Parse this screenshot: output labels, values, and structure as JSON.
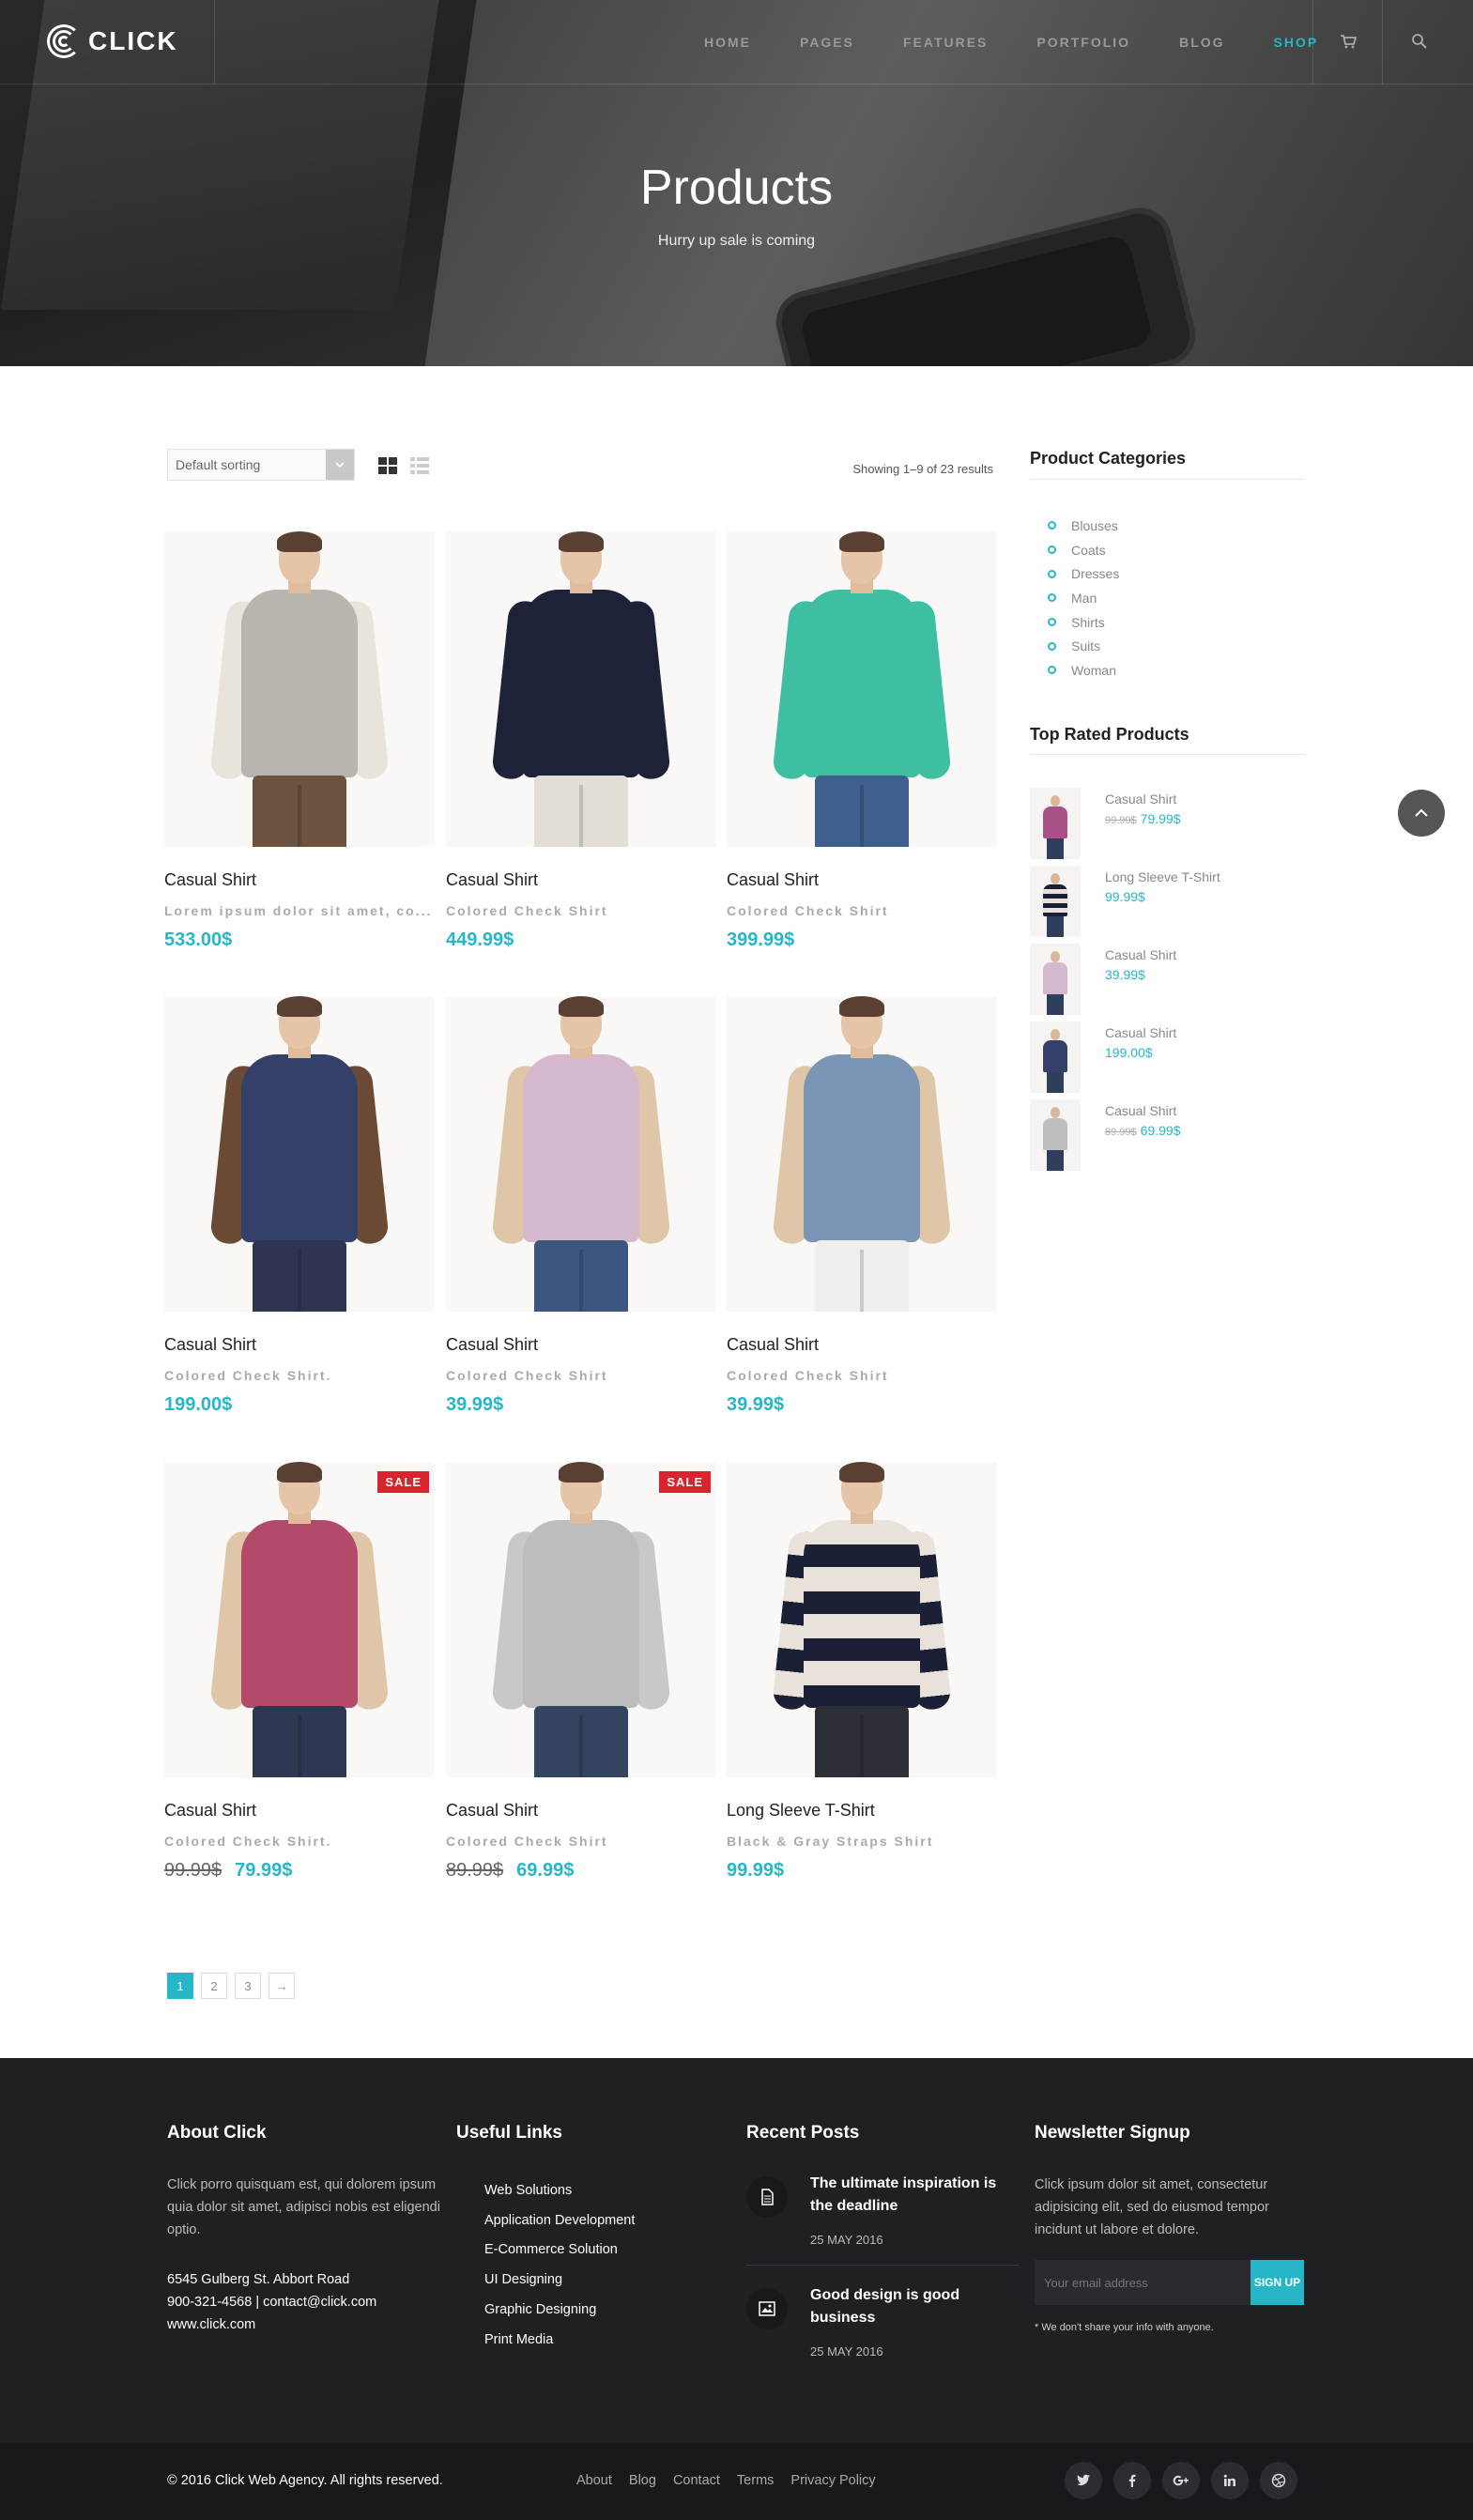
{
  "brand": {
    "logo_text": "CLICK"
  },
  "nav": {
    "items": [
      "HOME",
      "PAGES",
      "FEATURES",
      "PORTFOLIO",
      "BLOG",
      "SHOP"
    ],
    "active": "SHOP"
  },
  "hero": {
    "title": "Products",
    "subtitle": "Hurry up sale is coming"
  },
  "toolbar": {
    "sort_value": "Default sorting",
    "results": "Showing 1–9 of 23 results"
  },
  "products": [
    {
      "name": "Casual Shirt",
      "desc": "Lorem ipsum dolor sit amet, co...",
      "price": "533.00$",
      "old_price": "",
      "sale": false,
      "shirt": "#b9b5ae",
      "sleeve": "#e8e4dc",
      "pants": "#6b5340"
    },
    {
      "name": "Casual Shirt",
      "desc": "Colored Check Shirt",
      "price": "449.99$",
      "old_price": "",
      "sale": false,
      "shirt": "#1e2238",
      "sleeve": "#1e2238",
      "pants": "#e2ded5"
    },
    {
      "name": "Casual Shirt",
      "desc": "Colored Check Shirt",
      "price": "399.99$",
      "old_price": "",
      "sale": false,
      "shirt": "#3fbfa2",
      "sleeve": "#3fbfa2",
      "pants": "#3f5f8e"
    },
    {
      "name": "Casual Shirt",
      "desc": "Colored Check Shirt.",
      "price": "199.00$",
      "old_price": "",
      "sale": false,
      "shirt": "#34406a",
      "sleeve": "#6b4a35",
      "pants": "#2d3550"
    },
    {
      "name": "Casual Shirt",
      "desc": "Colored Check Shirt",
      "price": "39.99$",
      "old_price": "",
      "sale": false,
      "shirt": "#d5b8cc",
      "sleeve": "#e0c6a8",
      "pants": "#3c5680"
    },
    {
      "name": "Casual Shirt",
      "desc": "Colored Check Shirt",
      "price": "39.99$",
      "old_price": "",
      "sale": false,
      "shirt": "#7b95b4",
      "sleeve": "#e0c6a8",
      "pants": "#f0eeea"
    },
    {
      "name": "Casual Shirt",
      "desc": "Colored Check Shirt.",
      "price": "79.99$",
      "old_price": "99.99$",
      "sale": true,
      "sale_label": "SALE",
      "shirt": "#b44a6a",
      "sleeve": "#e0c6a8",
      "pants": "#2e3852"
    },
    {
      "name": "Casual Shirt",
      "desc": "Colored Check Shirt",
      "price": "69.99$",
      "old_price": "89.99$",
      "sale": true,
      "sale_label": "SALE",
      "shirt": "#bdbdbd",
      "sleeve": "#c8c8c8",
      "pants": "#34445f"
    },
    {
      "name": "Long Sleeve T-Shirt",
      "desc": "Black & Gray Straps Shirt",
      "price": "99.99$",
      "old_price": "",
      "sale": false,
      "shirt": "#e8e2da",
      "sleeve": "#1c2036",
      "pants": "#2d2f36",
      "striped": true
    }
  ],
  "pagination": {
    "pages": [
      "1",
      "2",
      "3",
      "→"
    ],
    "active": "1"
  },
  "sidebar": {
    "categories_title": "Product Categories",
    "categories": [
      "Blouses",
      "Coats",
      "Dresses",
      "Man",
      "Shirts",
      "Suits",
      "Woman"
    ],
    "top_rated_title": "Top Rated Products",
    "top_rated": [
      {
        "name": "Casual Shirt",
        "old_price": "99.99$",
        "price": "79.99$",
        "shirt": "#a9528a"
      },
      {
        "name": "Long Sleeve T-Shirt",
        "old_price": "",
        "price": "99.99$",
        "shirt": "#e8e2da",
        "striped": true
      },
      {
        "name": "Casual Shirt",
        "old_price": "",
        "price": "39.99$",
        "shirt": "#d5b8cc"
      },
      {
        "name": "Casual Shirt",
        "old_price": "",
        "price": "199.00$",
        "shirt": "#34406a"
      },
      {
        "name": "Casual Shirt",
        "old_price": "89.99$",
        "price": "69.99$",
        "shirt": "#bdbdbd"
      }
    ]
  },
  "footer": {
    "about": {
      "title": "About Click",
      "text": "Click porro quisquam est, qui dolorem ipsum quia dolor sit amet, adipisci nobis est eligendi optio.",
      "address": "6545 Gulberg St. Abbort Road",
      "contact": "900-321-4568 | contact@click.com",
      "web": "www.click.com"
    },
    "links": {
      "title": "Useful Links",
      "items": [
        "Web Solutions",
        "Application Development",
        "E-Commerce Solution",
        "UI Designing",
        "Graphic Designing",
        "Print Media"
      ]
    },
    "posts": {
      "title": "Recent Posts",
      "items": [
        {
          "title": "The ultimate inspiration is the deadline",
          "date": "25 MAY 2016",
          "icon": "document-icon"
        },
        {
          "title": "Good design is good business",
          "date": "25 MAY 2016",
          "icon": "image-icon"
        }
      ]
    },
    "newsletter": {
      "title": "Newsletter Signup",
      "text": "Click ipsum dolor sit amet, consectetur adipisicing elit, sed do eiusmod tempor incidunt ut labore et dolore.",
      "placeholder": "Your email address",
      "button": "SIGN UP",
      "note": "* We don't share your info with anyone."
    }
  },
  "bottom": {
    "copyright": "© 2016 Click Web Agency. All rights reserved.",
    "links": [
      "About",
      "Blog",
      "Contact",
      "Terms",
      "Privacy Policy"
    ],
    "socials": [
      "twitter-icon",
      "facebook-icon",
      "google-plus-icon",
      "linkedin-icon",
      "dribbble-icon"
    ]
  },
  "colors": {
    "accent": "#26b6c7",
    "sale": "#d9232f",
    "footer_bg": "#1f2024"
  }
}
